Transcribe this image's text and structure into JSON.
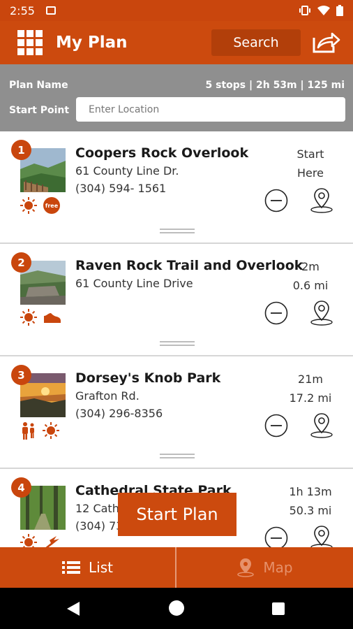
{
  "status_bar": {
    "time": "2:55",
    "icons": [
      "gallery-icon",
      "vibrate-icon",
      "wifi-icon",
      "battery-icon"
    ]
  },
  "app_bar": {
    "title": "My Plan",
    "search_label": "Search",
    "menu_icon": "grid-menu-icon",
    "share_icon": "share-icon"
  },
  "plan_info": {
    "plan_name_label": "Plan Name",
    "stats": "5 stops | 2h 53m | 125 mi",
    "start_point_label": "Start Point",
    "start_point_placeholder": "Enter Location"
  },
  "stops": [
    {
      "number": "1",
      "name": "Coopers Rock Overlook",
      "address": "61 County Line Dr.",
      "phone": "(304) 594- 1561",
      "meta_top": "Start",
      "meta_bottom": "Here",
      "amenities": [
        "sun-icon",
        "free-badge-icon"
      ],
      "free_label": "free"
    },
    {
      "number": "2",
      "name": "Raven Rock Trail and Overlook",
      "address": "61 County Line Drive",
      "phone": "",
      "meta_top": "2m",
      "meta_bottom": "0.6 mi",
      "amenities": [
        "sun-icon",
        "hiking-shoe-icon"
      ]
    },
    {
      "number": "3",
      "name": "Dorsey's Knob Park",
      "address": "Grafton Rd.",
      "phone": "(304) 296-8356",
      "meta_top": "21m",
      "meta_bottom": "17.2 mi",
      "amenities": [
        "family-icon",
        "sun-icon"
      ]
    },
    {
      "number": "4",
      "name": "Cathedral State Park",
      "address": "12 Cath",
      "phone": "(304) 73",
      "meta_top": "1h 13m",
      "meta_bottom": "50.3 mi",
      "amenities": [
        "sun-icon",
        "bird-icon"
      ]
    }
  ],
  "start_plan_label": "Start Plan",
  "bottom_nav": {
    "list_label": "List",
    "map_label": "Map"
  },
  "colors": {
    "brand_orange": "#cc4a0e",
    "header_gray": "#8f8f8f"
  }
}
